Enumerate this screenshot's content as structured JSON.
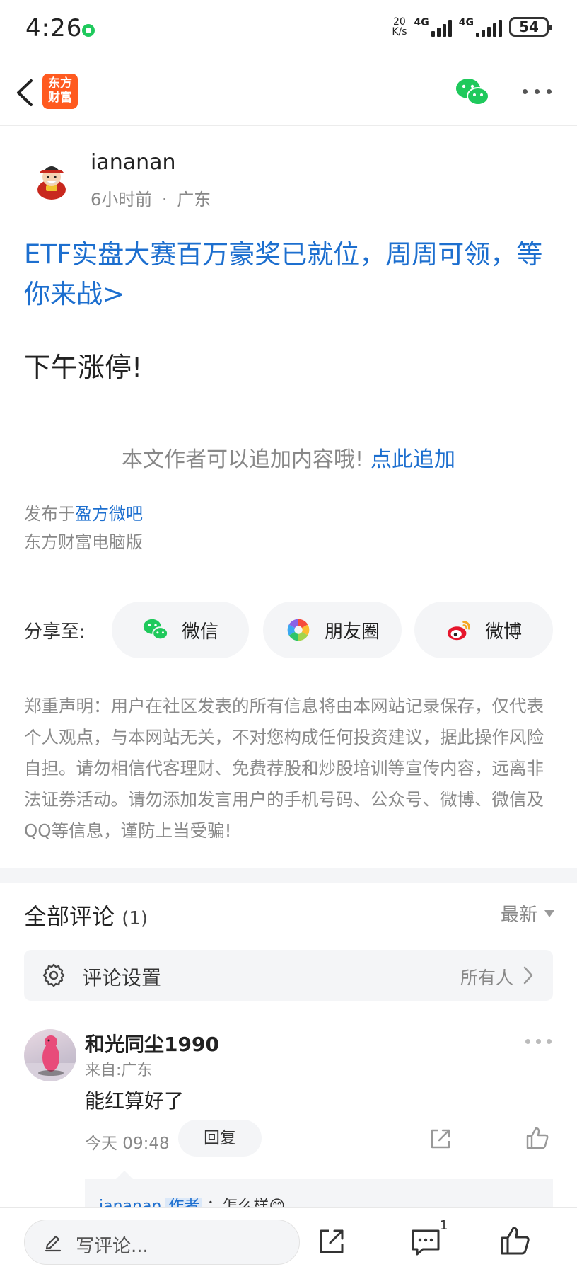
{
  "status_bar": {
    "time": "4:26",
    "net_speed_value": "20",
    "net_speed_unit": "K/s",
    "signal_1_label": "4G",
    "signal_2_label": "4G",
    "battery": "54"
  },
  "nav": {
    "logo_text_1": "东方",
    "logo_text_2": "财富"
  },
  "post": {
    "author": "iananan",
    "time_ago": "6小时前",
    "separator": "·",
    "location": "广东",
    "promo": "ETF实盘大赛百万豪奖已就位，周周可领，等你来战>",
    "content": "下午涨停!",
    "append_tip": "本文作者可以追加内容哦!",
    "append_link": "点此追加",
    "published_prefix": "发布于",
    "published_bar": "盈方微吧",
    "client": "东方财富电脑版"
  },
  "share": {
    "label": "分享至:",
    "options": [
      "微信",
      "朋友圈",
      "微博"
    ]
  },
  "disclaimer": "郑重声明：用户在社区发表的所有信息将由本网站记录保存，仅代表个人观点，与本网站无关，不对您构成任何投资建议，据此操作风险自担。请勿相信代客理财、免费荐股和炒股培训等宣传内容，远离非法证券活动。请勿添加发言用户的手机号码、公众号、微博、微信及QQ等信息，谨防上当受骗!",
  "comments": {
    "title": "全部评论",
    "count": "(1)",
    "sort": "最新",
    "settings_label": "评论设置",
    "settings_value": "所有人",
    "items": [
      {
        "name": "和光同尘1990",
        "location": "来自:广东",
        "text": "能红算好了",
        "time": "今天 09:48",
        "reply_label": "回复",
        "sub_reply": {
          "name": "iananan",
          "tag": "作者",
          "text": "：怎么样😊"
        }
      }
    ]
  },
  "bottom_bar": {
    "placeholder": "写评论...",
    "comment_count": "1"
  },
  "colors": {
    "accent_blue": "#1d6fcf",
    "brand_orange": "#ff5a1f",
    "wechat_green": "#1fc95c"
  }
}
